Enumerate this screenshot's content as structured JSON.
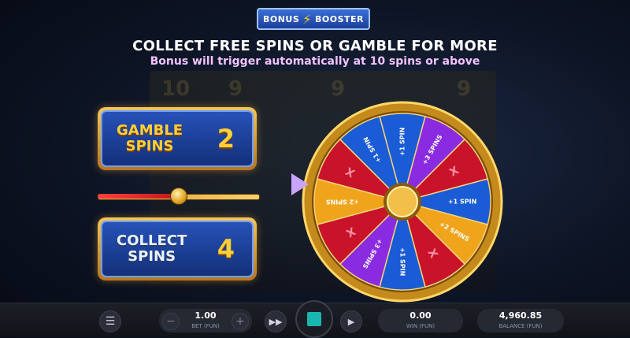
{
  "logo": {
    "left": "BONUS",
    "right": "BOOSTER"
  },
  "header": {
    "title": "COLLECT FREE SPINS OR GAMBLE FOR MORE",
    "subtitle": "Bonus will trigger automatically at 10 spins or above"
  },
  "background_reel": {
    "numbers": [
      "10",
      "9",
      "9",
      "9"
    ]
  },
  "gamble_panel": {
    "label": "GAMBLE\nSPINS",
    "value": "2"
  },
  "collect_panel": {
    "label": "COLLECT\nSPINS",
    "value": "4"
  },
  "slider": {
    "position": 0.5
  },
  "wheel": {
    "segments": [
      {
        "label": "+1 SPIN",
        "color": "#1a5bd6"
      },
      {
        "label": "+3 SPINS",
        "color": "#8a2be2"
      },
      {
        "label": "X",
        "color": "#c8132a"
      },
      {
        "label": "+1 SPIN",
        "color": "#1a5bd6"
      },
      {
        "label": "+2 SPINS",
        "color": "#f0a41c"
      },
      {
        "label": "X",
        "color": "#c8132a"
      },
      {
        "label": "+1 SPIN",
        "color": "#1a5bd6"
      },
      {
        "label": "+3 SPINS",
        "color": "#8a2be2"
      },
      {
        "label": "X",
        "color": "#c8132a"
      },
      {
        "label": "+2 SPINS",
        "color": "#f0a41c"
      },
      {
        "label": "X",
        "color": "#c8132a"
      },
      {
        "label": "+1 SPIN",
        "color": "#1a5bd6"
      }
    ]
  },
  "bottom_bar": {
    "menu_icon": "hamburger-icon",
    "bet_value": "1.00",
    "bet_label": "BET (FUN)",
    "win_value": "0.00",
    "win_label": "WIN (FUN)",
    "balance_value": "4,960.85",
    "balance_label": "BALANCE (FUN)",
    "minus": "−",
    "plus": "+",
    "menu": "☰",
    "fast_forward": "▶▶",
    "autoplay": "▶"
  }
}
